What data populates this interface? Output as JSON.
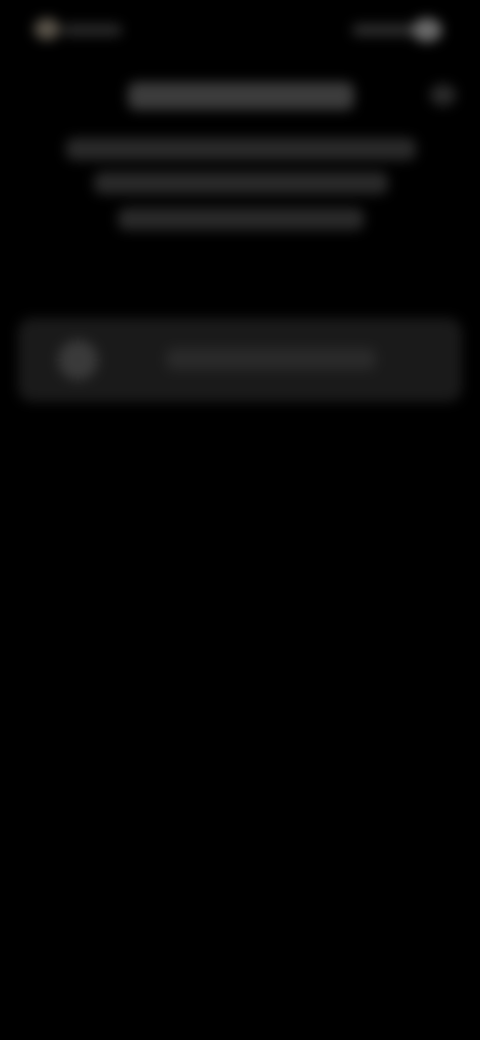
{
  "screen": {
    "background": "#000000",
    "blurred": true
  },
  "status_bar": {
    "left_indicator_icon": "status-dot-icon",
    "right_indicator_icon": "status-indicator-icon"
  },
  "header": {
    "info_icon": "info-icon"
  },
  "card": {
    "avatar_icon": "avatar-icon"
  },
  "colors": {
    "background": "#000000",
    "card": "#1a1a1a",
    "text_placeholder": "#2a2a2a",
    "title_placeholder": "#3c3c3c"
  }
}
